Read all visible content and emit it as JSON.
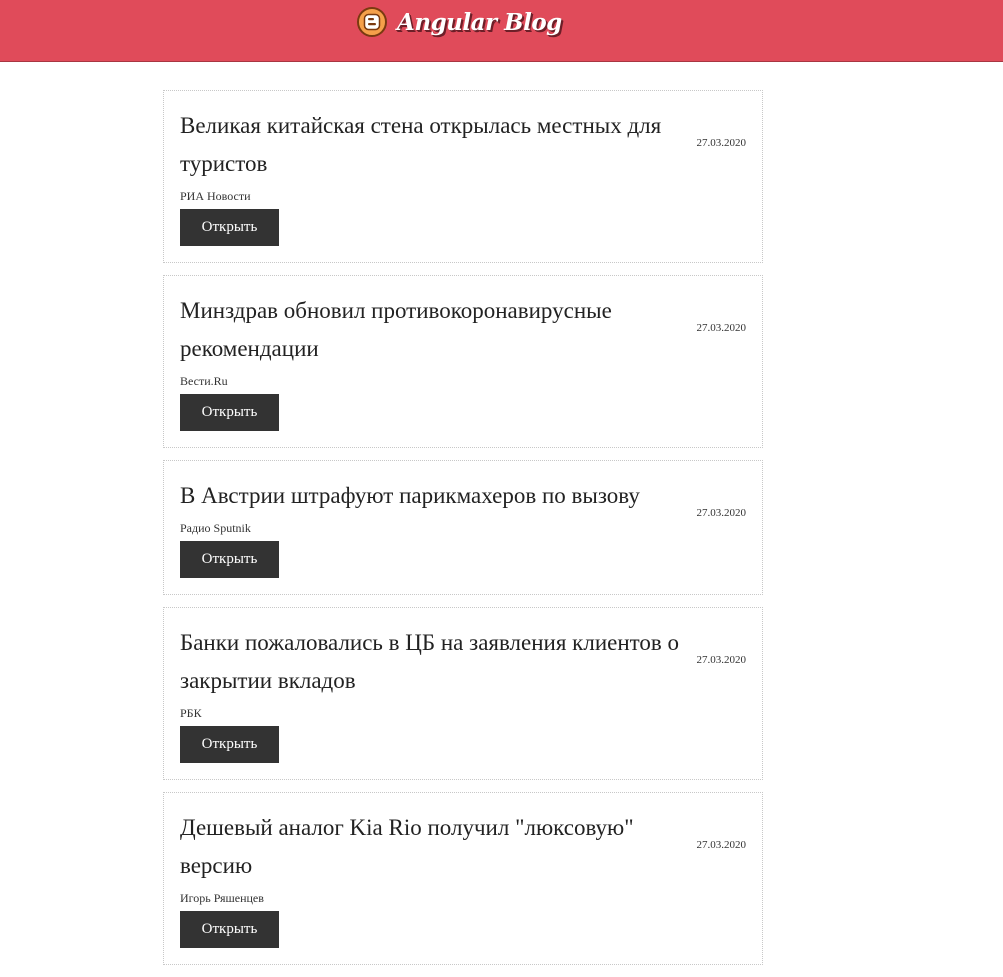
{
  "header": {
    "brand": "Angular Blog",
    "logo_icon": "blogger-icon",
    "bg_color": "#e04b5a"
  },
  "posts": [
    {
      "title": "Великая китайская стена открылась местных для туристов",
      "source": "РИА Новости",
      "date": "27.03.2020",
      "button": "Открыть"
    },
    {
      "title": "Минздрав обновил противокоронавирусные рекомендации",
      "source": "Вести.Ru",
      "date": "27.03.2020",
      "button": "Открыть"
    },
    {
      "title": "В Австрии штрафуют парикмахеров по вызову",
      "source": "Радио Sputnik",
      "date": "27.03.2020",
      "button": "Открыть"
    },
    {
      "title": "Банки пожаловались в ЦБ на заявления клиентов о закрытии вкладов",
      "source": "РБК",
      "date": "27.03.2020",
      "button": "Открыть"
    },
    {
      "title": "Дешевый аналог Kia Rio получил \"люксовую\" версию",
      "source": "Игорь Ряшенцев",
      "date": "27.03.2020",
      "button": "Открыть"
    }
  ]
}
